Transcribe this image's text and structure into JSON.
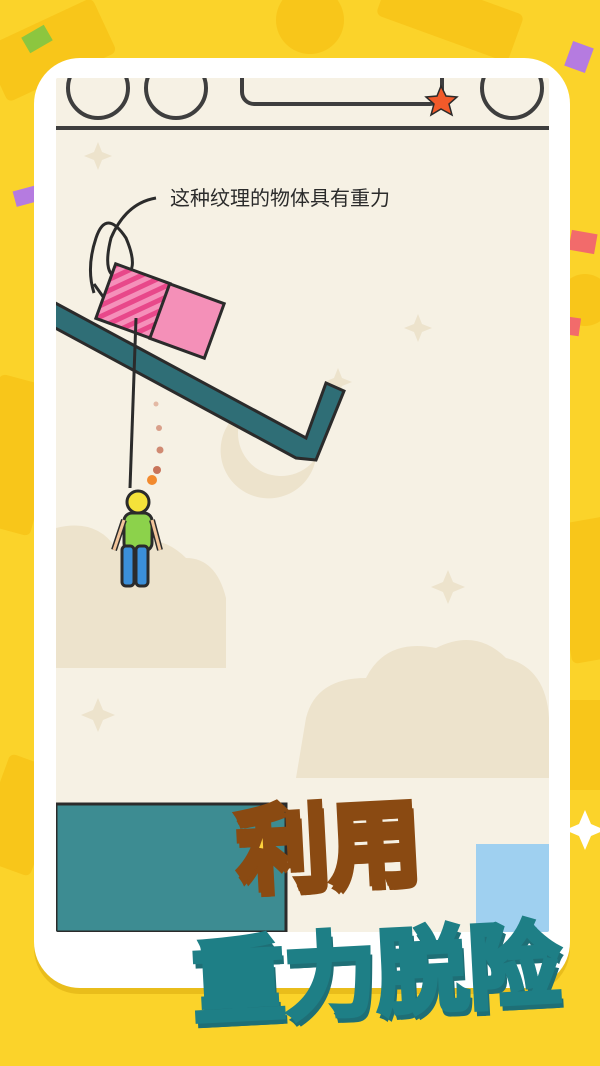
{
  "hint": {
    "text": "这种纹理的物体具有重力"
  },
  "title": {
    "line1": "利用",
    "line2": "重力脱险"
  },
  "colors": {
    "background": "#FBD32A",
    "screen_bg": "#F6F1E4",
    "ramp": "#2F6E76",
    "water": "#3D8C92",
    "striped_box": "#F06BA0",
    "plain_box": "#F490B8",
    "title_yellow": "#FFD23C",
    "title_teal": "#1E7F86"
  }
}
